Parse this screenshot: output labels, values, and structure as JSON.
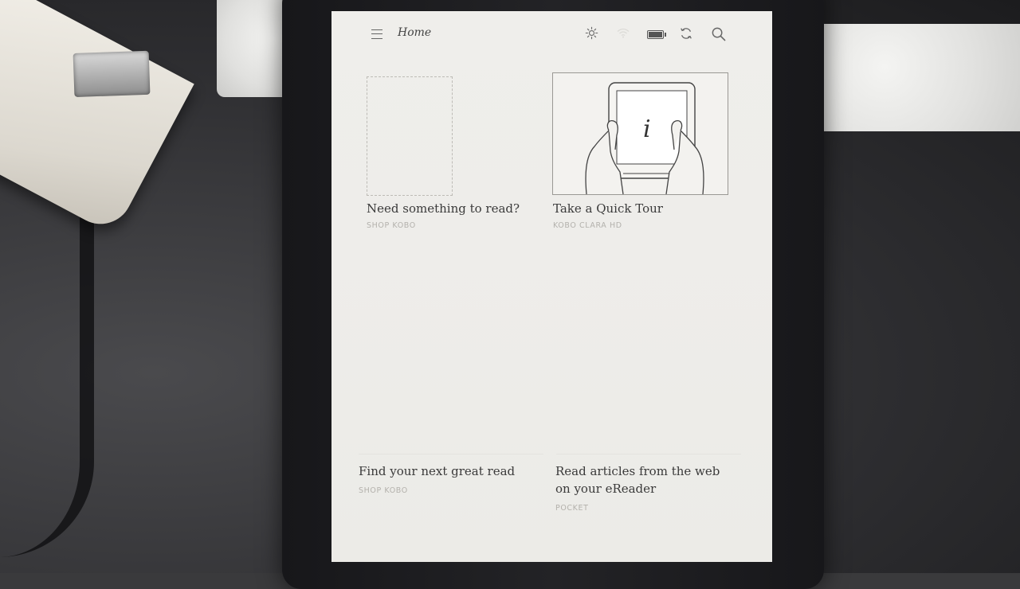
{
  "header": {
    "title": "Home",
    "icons": [
      "menu-icon",
      "brightness-icon",
      "wifi-icon",
      "battery-icon",
      "sync-icon",
      "search-icon"
    ]
  },
  "tiles": [
    {
      "title": "Need something to read?",
      "subtitle": "SHOP KOBO"
    },
    {
      "title": "Take a Quick Tour",
      "subtitle": "KOBO CLARA HD",
      "illustration_letter": "i"
    },
    {
      "title": "Find your next great read",
      "subtitle": "SHOP KOBO"
    },
    {
      "title_line1": "Read articles from the web",
      "title_line2": "on your eReader",
      "subtitle": "POCKET"
    }
  ],
  "colors": {
    "screen": "#eeedea",
    "text": "#3a3a3a",
    "muted": "#b3b1ac",
    "bezel": "#1d1d20"
  }
}
